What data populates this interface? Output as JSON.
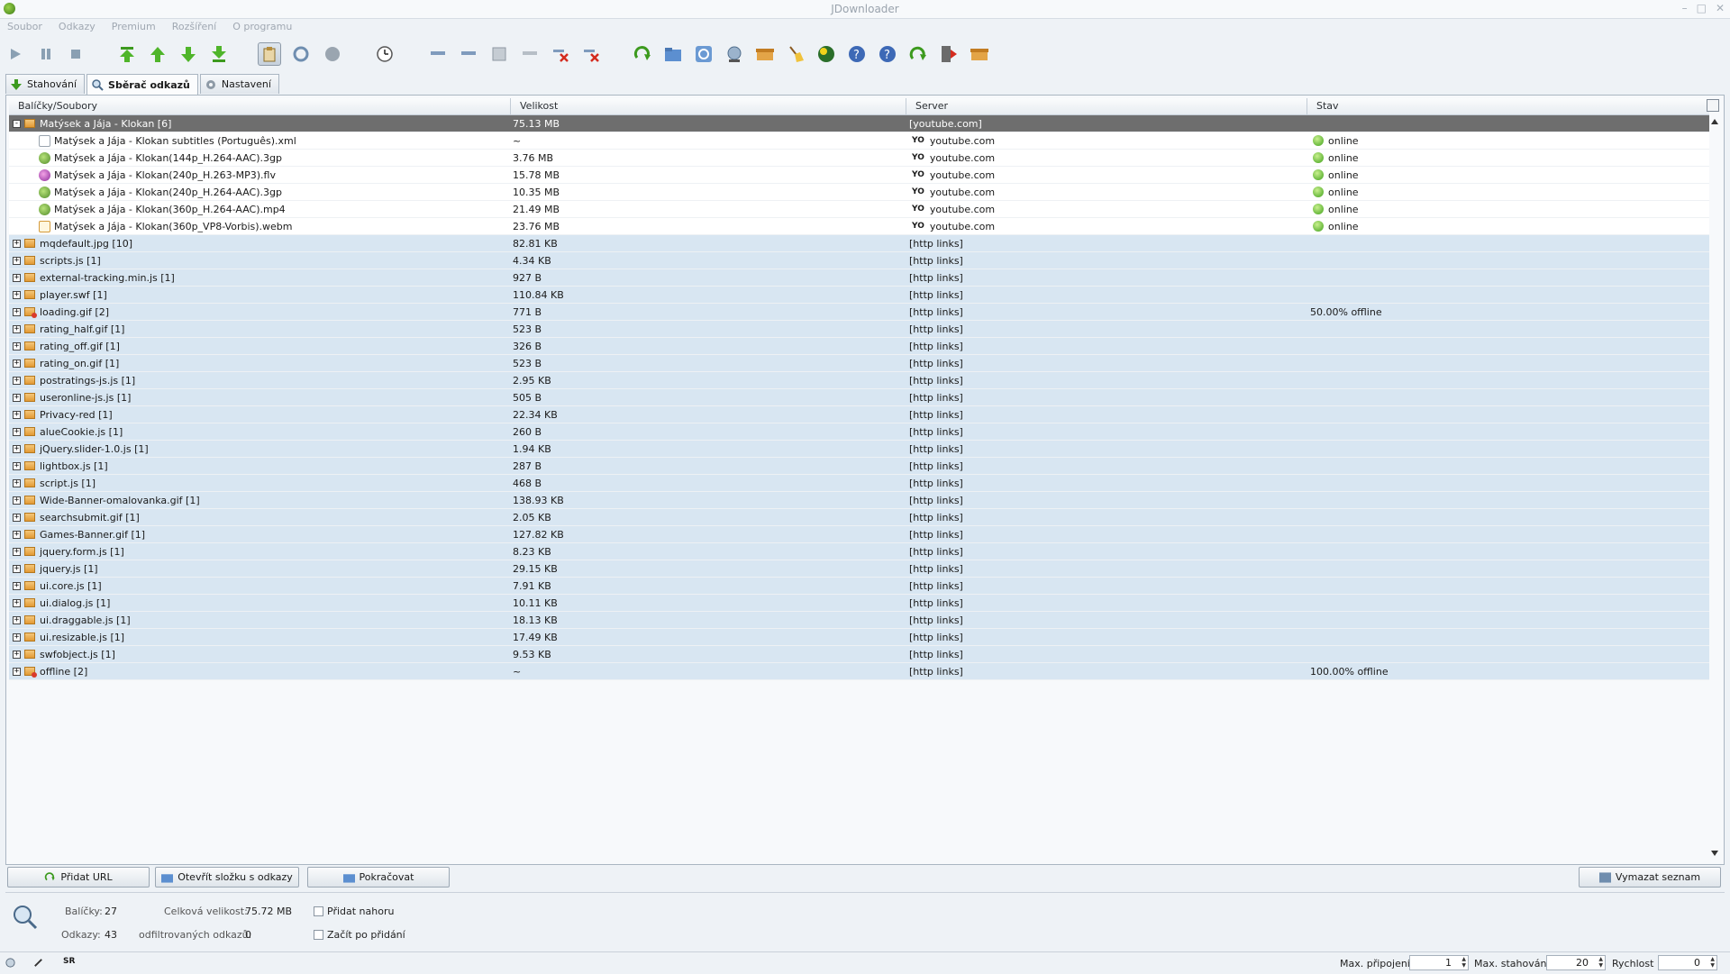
{
  "window": {
    "title": "JDownloader"
  },
  "menu": [
    "Soubor",
    "Odkazy",
    "Premium",
    "Rozšíření",
    "O programu"
  ],
  "toolbar": {
    "icons": [
      "play-icon",
      "pause-icon",
      "stop-icon",
      "move-top-icon",
      "move-up-icon",
      "move-down-icon",
      "move-bottom-icon",
      "clipboard-icon",
      "reconnect-icon",
      "shutdown-icon",
      "update-icon",
      "remove-icon",
      "remove-icon",
      "remove-icon",
      "remove-icon",
      "delete-icon",
      "delete-icon",
      "add-icon",
      "folder-icon",
      "refresh-icon",
      "network-icon",
      "package-icon",
      "broom-icon",
      "globe-icon",
      "help-icon",
      "help-icon",
      "arrow-icon",
      "exit-icon",
      "package-icon"
    ]
  },
  "tabs": [
    {
      "label": "Stahování",
      "icon": "download-icon"
    },
    {
      "label": "Sběrač odkazů",
      "icon": "search-icon"
    },
    {
      "label": "Nastavení",
      "icon": "gear-icon"
    }
  ],
  "table": {
    "columns": [
      "Balíčky/Soubory",
      "Velikost",
      "Server",
      "Stav"
    ],
    "package": {
      "name": "Matýsek a Jája - Klokan [6]",
      "size": "75.13 MB",
      "server": "[youtube.com]",
      "status": ""
    },
    "files": [
      {
        "name": "Matýsek a Jája - Klokan subtitles (Português).xml",
        "size": "~",
        "server": "youtube.com",
        "status": "online",
        "icon": "xml"
      },
      {
        "name": "Matýsek a Jája - Klokan(144p_H.264-AAC).3gp",
        "size": "3.76 MB",
        "server": "youtube.com",
        "status": "online",
        "icon": "3gp"
      },
      {
        "name": "Matýsek a Jája - Klokan(240p_H.263-MP3).flv",
        "size": "15.78 MB",
        "server": "youtube.com",
        "status": "online",
        "icon": "flv"
      },
      {
        "name": "Matýsek a Jája - Klokan(240p_H.264-AAC).3gp",
        "size": "10.35 MB",
        "server": "youtube.com",
        "status": "online",
        "icon": "3gp"
      },
      {
        "name": "Matýsek a Jája - Klokan(360p_H.264-AAC).mp4",
        "size": "21.49 MB",
        "server": "youtube.com",
        "status": "online",
        "icon": "3gp"
      },
      {
        "name": "Matýsek a Jája - Klokan(360p_VP8-Vorbis).webm",
        "size": "23.76 MB",
        "server": "youtube.com",
        "status": "online",
        "icon": "webm"
      }
    ],
    "server_badge": "YO",
    "packages": [
      {
        "name": "mqdefault.jpg [10]",
        "size": "82.81 KB",
        "server": "[http links]",
        "status": ""
      },
      {
        "name": "scripts.js [1]",
        "size": "4.34 KB",
        "server": "[http links]",
        "status": ""
      },
      {
        "name": "external-tracking.min.js [1]",
        "size": "927 B",
        "server": "[http links]",
        "status": ""
      },
      {
        "name": "player.swf [1]",
        "size": "110.84 KB",
        "server": "[http links]",
        "status": ""
      },
      {
        "name": "loading.gif [2]",
        "size": "771 B",
        "server": "[http links]",
        "status": "50.00% offline",
        "warn": true
      },
      {
        "name": "rating_half.gif [1]",
        "size": "523 B",
        "server": "[http links]",
        "status": ""
      },
      {
        "name": "rating_off.gif [1]",
        "size": "326 B",
        "server": "[http links]",
        "status": ""
      },
      {
        "name": "rating_on.gif [1]",
        "size": "523 B",
        "server": "[http links]",
        "status": ""
      },
      {
        "name": "postratings-js.js [1]",
        "size": "2.95 KB",
        "server": "[http links]",
        "status": ""
      },
      {
        "name": "useronline-js.js [1]",
        "size": "505 B",
        "server": "[http links]",
        "status": ""
      },
      {
        "name": "Privacy-red [1]",
        "size": "22.34 KB",
        "server": "[http links]",
        "status": ""
      },
      {
        "name": "alueCookie.js [1]",
        "size": "260 B",
        "server": "[http links]",
        "status": ""
      },
      {
        "name": "jQuery.slider-1.0.js [1]",
        "size": "1.94 KB",
        "server": "[http links]",
        "status": ""
      },
      {
        "name": "lightbox.js [1]",
        "size": "287 B",
        "server": "[http links]",
        "status": ""
      },
      {
        "name": "script.js [1]",
        "size": "468 B",
        "server": "[http links]",
        "status": ""
      },
      {
        "name": "Wide-Banner-omalovanka.gif [1]",
        "size": "138.93 KB",
        "server": "[http links]",
        "status": ""
      },
      {
        "name": "searchsubmit.gif [1]",
        "size": "2.05 KB",
        "server": "[http links]",
        "status": ""
      },
      {
        "name": "Games-Banner.gif [1]",
        "size": "127.82 KB",
        "server": "[http links]",
        "status": ""
      },
      {
        "name": "jquery.form.js [1]",
        "size": "8.23 KB",
        "server": "[http links]",
        "status": ""
      },
      {
        "name": "jquery.js [1]",
        "size": "29.15 KB",
        "server": "[http links]",
        "status": ""
      },
      {
        "name": "ui.core.js [1]",
        "size": "7.91 KB",
        "server": "[http links]",
        "status": ""
      },
      {
        "name": "ui.dialog.js [1]",
        "size": "10.11 KB",
        "server": "[http links]",
        "status": ""
      },
      {
        "name": "ui.draggable.js [1]",
        "size": "18.13 KB",
        "server": "[http links]",
        "status": ""
      },
      {
        "name": "ui.resizable.js [1]",
        "size": "17.49 KB",
        "server": "[http links]",
        "status": ""
      },
      {
        "name": "swfobject.js [1]",
        "size": "9.53 KB",
        "server": "[http links]",
        "status": ""
      },
      {
        "name": "offline [2]",
        "size": "~",
        "server": "[http links]",
        "status": "100.00% offline",
        "warn": true
      }
    ]
  },
  "buttons": {
    "add_url": "Přidat URL",
    "open_folder": "Otevřít složku s odkazy",
    "continue": "Pokračovat",
    "clear_list": "Vymazat seznam"
  },
  "info": {
    "packages_label": "Balíčky:",
    "packages_value": "27",
    "total_size_label": "Celková velikost:",
    "total_size_value": "75.72 MB",
    "links_label": "Odkazy:",
    "links_value": "43",
    "filtered_label": "odfiltrovaných odkazů:",
    "filtered_value": "0",
    "add_top_label": "Přidat nahoru",
    "start_after_add_label": "Začít po přidání"
  },
  "statusbar": {
    "badge": "SR",
    "max_connections_label": "Max. připojení",
    "max_connections_value": "1",
    "max_downloads_label": "Max. stahování",
    "max_downloads_value": "20",
    "speed_label": "Rychlost",
    "speed_value": "0"
  },
  "colors": {
    "selected_row": "#6e6e6e",
    "package_row": "#d8e6f2",
    "accent_green": "#3fa11b"
  }
}
